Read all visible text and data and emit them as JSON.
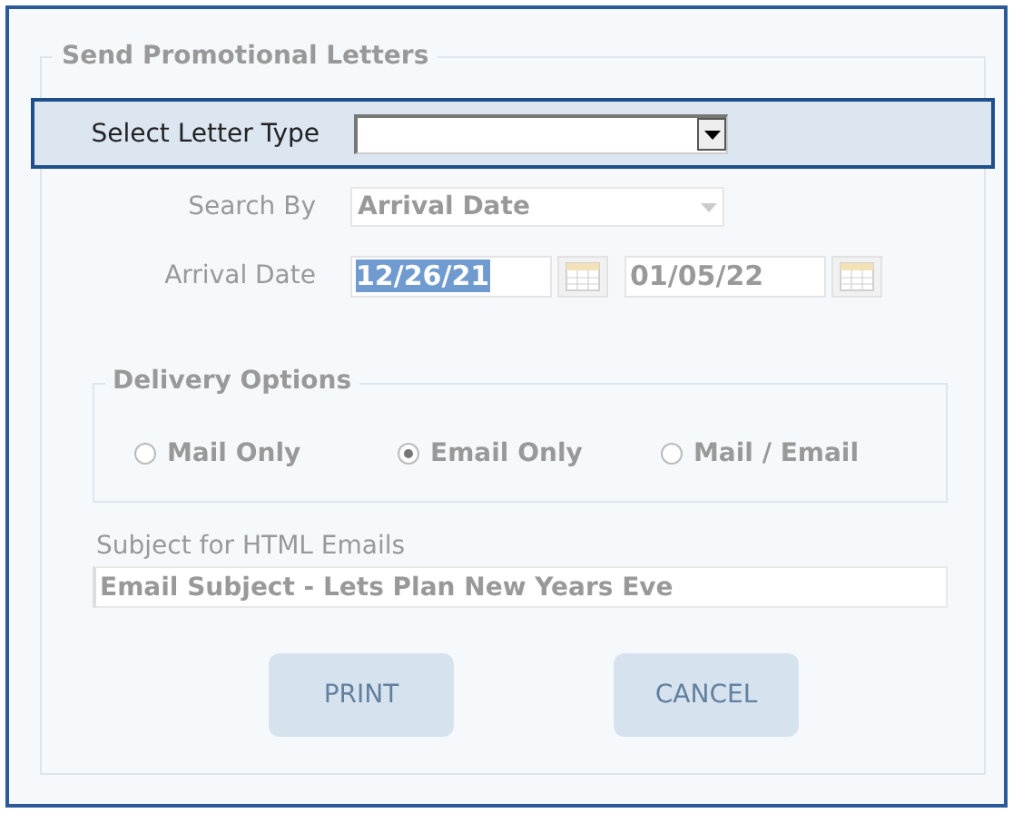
{
  "panel": {
    "title": "Send Promotional Letters"
  },
  "letter_type": {
    "label": "Select Letter Type",
    "disabled": false
  },
  "search_by": {
    "label": "Search By",
    "value": "Arrival Date",
    "disabled": true
  },
  "arrival_date": {
    "label": "Arrival Date",
    "disabled": true,
    "from": {
      "value": "12/26/21",
      "highlighted": true
    },
    "to": {
      "value": "01/05/22",
      "highlighted": false
    }
  },
  "delivery_options": {
    "title": "Delivery  Options",
    "disabled": true,
    "options": [
      {
        "label": "Mail Only",
        "selected": false
      },
      {
        "label": "Email Only",
        "selected": true
      },
      {
        "label": "Mail / Email",
        "selected": false
      }
    ]
  },
  "subject": {
    "label": "Subject for HTML Emails",
    "value": "Email Subject - Lets Plan New Years Eve",
    "disabled": true
  },
  "buttons": [
    {
      "label": "PRINT",
      "disabled": true
    },
    {
      "label": "CANCEL",
      "disabled": true
    }
  ]
}
